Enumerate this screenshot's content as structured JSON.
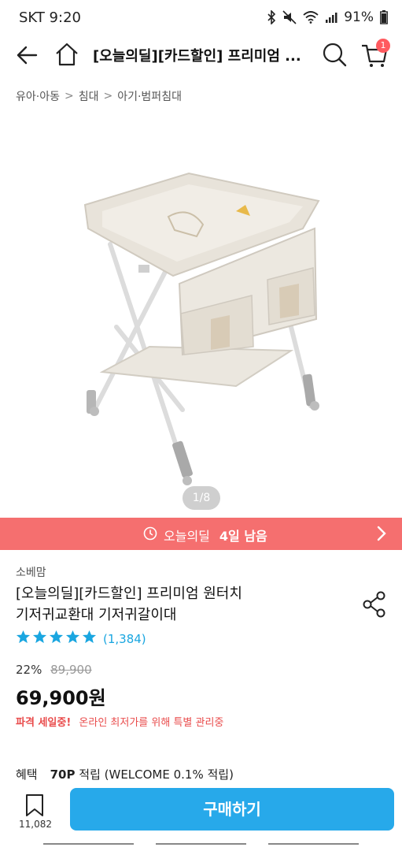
{
  "status_bar": {
    "carrier_time": "SKT 9:20",
    "battery": "91%"
  },
  "header": {
    "title": "[오늘의딜][카드할인] 프리미엄 ...",
    "cart_count": "1"
  },
  "breadcrumb": [
    "유아·아동",
    "침대",
    "아기·범퍼침대"
  ],
  "image_counter": "1/8",
  "deal_banner": {
    "label": "오늘의딜",
    "days_left": "4일 남음"
  },
  "product": {
    "brand": "소베맘",
    "name_line1": "[오늘의딜][카드할인] 프리미엄 원터치",
    "name_line2": "기저귀교환대 기저귀갈이대",
    "rating_count": "(1,384)",
    "discount": "22%",
    "original_price": "89,900",
    "price": "69,900원",
    "sale_hot": "파격 세일중!",
    "sale_desc": "온라인 최저가를 위해 특별 관리중"
  },
  "benefit": {
    "label": "혜택",
    "points": "70P",
    "text": "적립 (WELCOME 0.1% 적립)"
  },
  "bottom_bar": {
    "wish_count": "11,082",
    "buy_label": "구매하기"
  },
  "colors": {
    "accent": "#27a9ea",
    "banner": "#f56f6f",
    "star": "#1aa6e0"
  }
}
